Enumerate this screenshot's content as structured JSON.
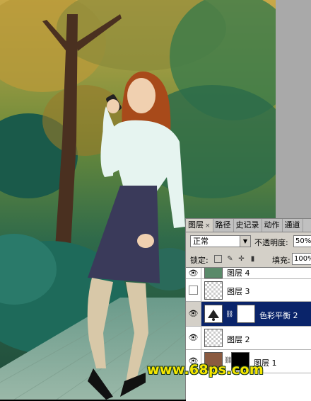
{
  "layers_panel": {
    "tabs": [
      {
        "label": "图层",
        "close": "×"
      },
      {
        "label": "路径"
      },
      {
        "label": "史记录"
      },
      {
        "label": "动作"
      },
      {
        "label": "通道"
      }
    ],
    "blend_mode": "正常",
    "opacity_label": "不透明度:",
    "opacity_value": "50%",
    "lock_label": "锁定:",
    "fill_label": "填充:",
    "fill_value": "100%",
    "layers": [
      {
        "name": "图层 4",
        "visible": true,
        "selected": false
      },
      {
        "name": "图层 3",
        "visible": false,
        "selected": false
      },
      {
        "name": "色彩平衡 2",
        "visible": true,
        "selected": true
      },
      {
        "name": "图层 2",
        "visible": true,
        "selected": false
      },
      {
        "name": "图层 1",
        "visible": true,
        "selected": false
      }
    ]
  },
  "watermark": "www.68ps.com",
  "icons": [
    "eye-icon",
    "lock-transparent-icon",
    "lock-paint-icon",
    "lock-move-icon",
    "lock-all-icon",
    "chain-link-icon",
    "dropdown-arrow-icon"
  ]
}
